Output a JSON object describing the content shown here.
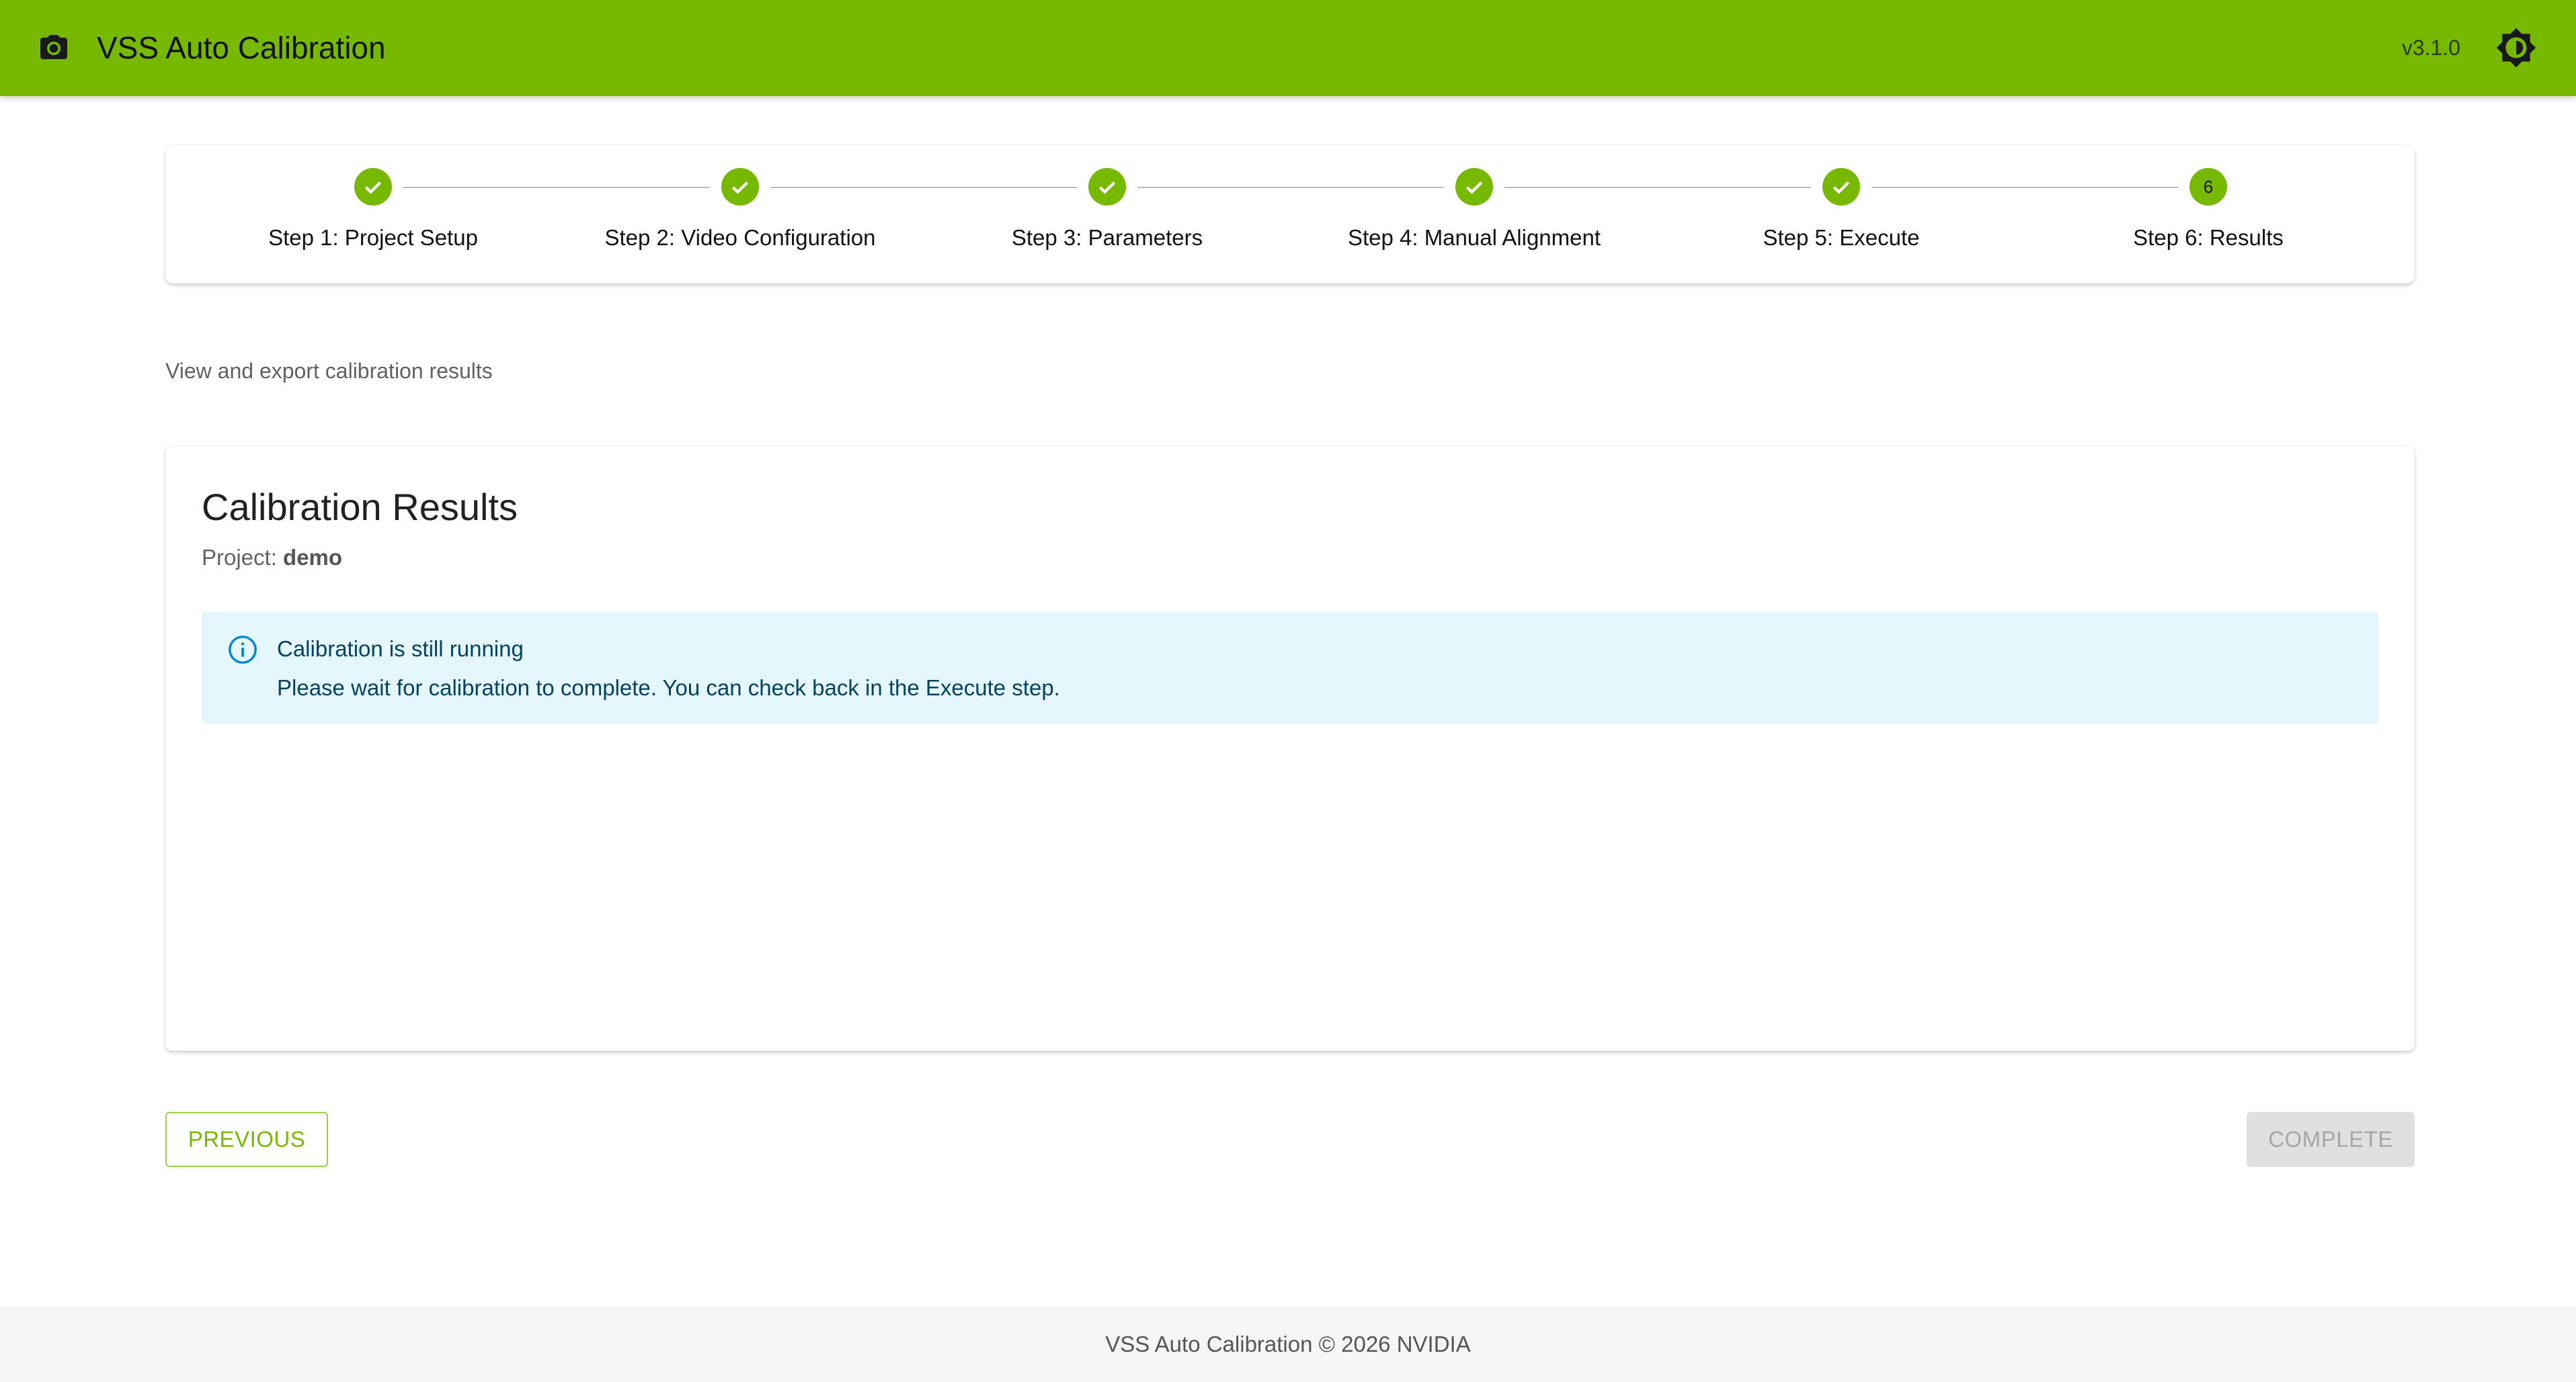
{
  "app": {
    "title": "VSS Auto Calibration",
    "version": "v3.1.0",
    "accent_color": "#76b900"
  },
  "header_icons": {
    "app_icon": "camera-icon",
    "theme_toggle": "brightness-icon"
  },
  "stepper": {
    "steps": [
      {
        "label": "Step 1: Project Setup",
        "status": "completed",
        "number": "1"
      },
      {
        "label": "Step 2: Video Configuration",
        "status": "completed",
        "number": "2"
      },
      {
        "label": "Step 3: Parameters",
        "status": "completed",
        "number": "3"
      },
      {
        "label": "Step 4: Manual Alignment",
        "status": "completed",
        "number": "4"
      },
      {
        "label": "Step 5: Execute",
        "status": "completed",
        "number": "5"
      },
      {
        "label": "Step 6: Results",
        "status": "active",
        "number": "6"
      }
    ]
  },
  "page": {
    "subtitle": "View and export calibration results"
  },
  "results": {
    "heading": "Calibration Results",
    "project_label": "Project: ",
    "project_name": "demo",
    "alert": {
      "severity": "info",
      "icon": "info-icon",
      "title": "Calibration is still running",
      "message": "Please wait for calibration to complete. You can check back in the Execute step."
    }
  },
  "navigation": {
    "previous_label": "PREVIOUS",
    "complete_label": "COMPLETE",
    "complete_disabled": true
  },
  "footer": {
    "text": "VSS Auto Calibration © 2026 NVIDIA"
  }
}
